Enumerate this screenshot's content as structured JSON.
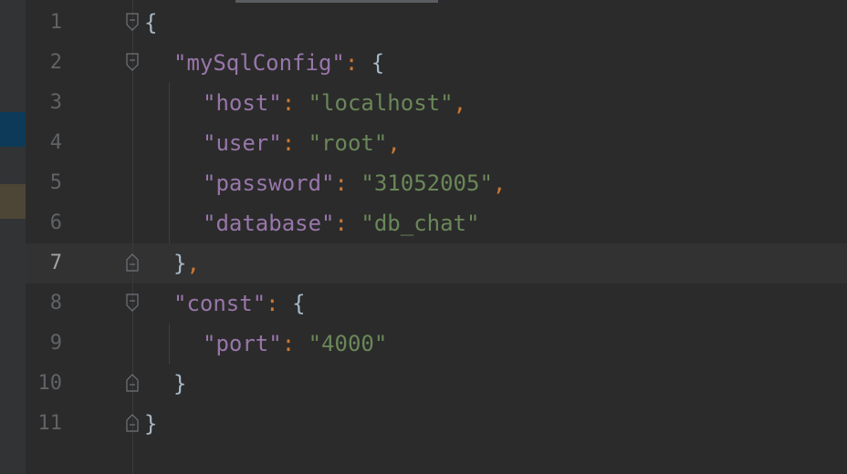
{
  "editor": {
    "lines": [
      {
        "number": "1"
      },
      {
        "number": "2",
        "key": "\"mySqlConfig\""
      },
      {
        "number": "3",
        "key": "\"host\"",
        "value": "\"localhost\""
      },
      {
        "number": "4",
        "key": "\"user\"",
        "value": "\"root\""
      },
      {
        "number": "5",
        "key": "\"password\"",
        "value": "\"31052005\""
      },
      {
        "number": "6",
        "key": "\"database\"",
        "value": "\"db_chat\""
      },
      {
        "number": "7"
      },
      {
        "number": "8",
        "key": "\"const\""
      },
      {
        "number": "9",
        "key": "\"port\"",
        "value": "\"4000\""
      },
      {
        "number": "10"
      },
      {
        "number": "11"
      }
    ],
    "current_line": "7",
    "colors": {
      "background": "#2b2b2b",
      "key": "#9876aa",
      "string": "#6a8759",
      "punctuation": "#cc7832",
      "brace": "#a9b7c6",
      "line_number": "#606366"
    }
  }
}
